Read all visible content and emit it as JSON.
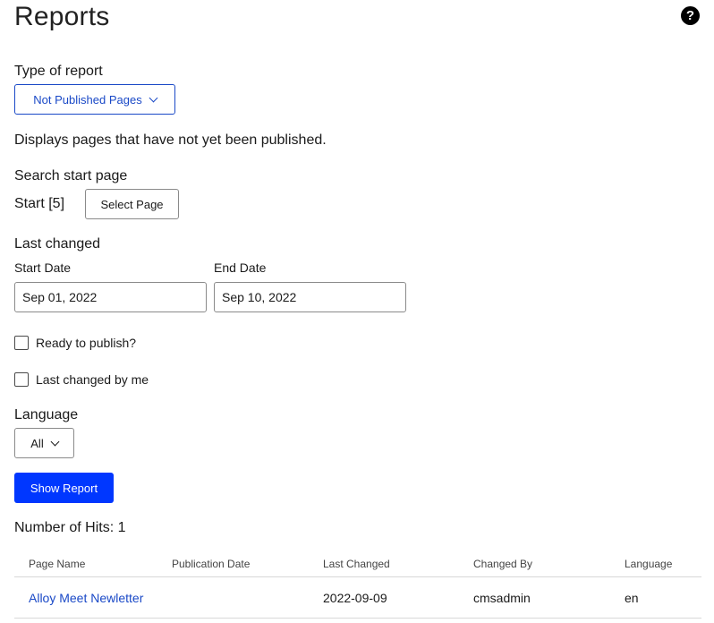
{
  "page": {
    "title": "Reports",
    "help_icon": "?"
  },
  "report_type": {
    "label": "Type of report",
    "selected": "Not Published Pages",
    "description": "Displays pages that have not yet been published."
  },
  "search_start": {
    "label": "Search start page",
    "value": "Start [5]",
    "button_label": "Select Page"
  },
  "last_changed": {
    "label": "Last changed",
    "start_label": "Start Date",
    "start_value": "Sep 01, 2022",
    "end_label": "End Date",
    "end_value": "Sep 10, 2022"
  },
  "checkboxes": {
    "ready_label": "Ready to publish?",
    "ready_checked": false,
    "mine_label": "Last changed by me",
    "mine_checked": false
  },
  "language": {
    "label": "Language",
    "selected": "All"
  },
  "show_report_label": "Show Report",
  "hits": "Number of Hits: 1",
  "table": {
    "headers": [
      "Page Name",
      "Publication Date",
      "Last Changed",
      "Changed By",
      "Language"
    ],
    "rows": [
      [
        "Alloy Meet Newletter",
        "",
        "2022-09-09",
        "cmsadmin",
        "en"
      ]
    ]
  },
  "colors": {
    "accent": "#1a49c7",
    "primary_button": "#0037ff"
  }
}
